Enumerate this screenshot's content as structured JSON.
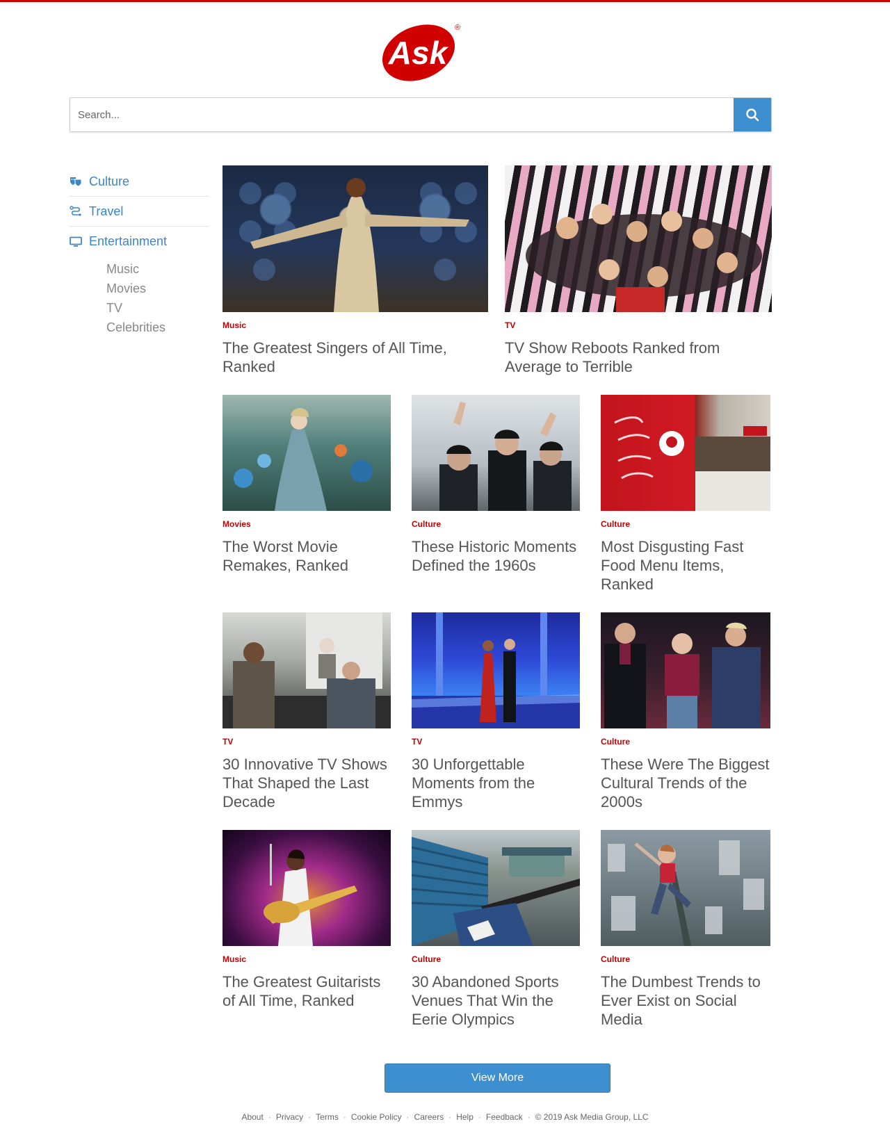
{
  "brand": {
    "logo_text": "Ask",
    "registered": "®",
    "accent": "#d10000",
    "link_blue": "#3b86c6",
    "button_blue": "#3d8fcf"
  },
  "search": {
    "placeholder": "Search...",
    "value": "",
    "icon": "search-icon"
  },
  "sidebar": {
    "items": [
      {
        "label": "Culture",
        "icon": "theater-masks-icon"
      },
      {
        "label": "Travel",
        "icon": "route-icon"
      },
      {
        "label": "Entertainment",
        "icon": "monitor-icon"
      }
    ],
    "subitems": [
      "Music",
      "Movies",
      "TV",
      "Celebrities"
    ]
  },
  "articles": [
    {
      "category": "Music",
      "title": "The Greatest Singers of All Time, Ranked",
      "image": "singer-on-stage-photo"
    },
    {
      "category": "TV",
      "title": "TV Show Reboots Ranked from Average to Terrible",
      "image": "tv-cast-group-photo"
    },
    {
      "category": "Movies",
      "title": "The Worst Movie Remakes, Ranked",
      "image": "fantasy-garden-movie-still"
    },
    {
      "category": "Culture",
      "title": "These Historic Moments Defined the 1960s",
      "image": "band-waving-photo"
    },
    {
      "category": "Culture",
      "title": "Most Disgusting Fast Food Menu Items, Ranked",
      "image": "fast-food-restaurant-photo"
    },
    {
      "category": "TV",
      "title": "30 Innovative TV Shows That Shaped the Last Decade",
      "image": "tv-drama-office-still"
    },
    {
      "category": "TV",
      "title": "30 Unforgettable Moments from the Emmys",
      "image": "awards-stage-photo"
    },
    {
      "category": "Culture",
      "title": "These Were The Biggest Cultural Trends of the 2000s",
      "image": "talent-show-hosts-photo"
    },
    {
      "category": "Music",
      "title": "The Greatest Guitarists of All Time, Ranked",
      "image": "guitarist-concert-photo"
    },
    {
      "category": "Culture",
      "title": "30 Abandoned Sports Venues That Win the Eerie Olympics",
      "image": "abandoned-stadium-photo"
    },
    {
      "category": "Culture",
      "title": "The Dumbest Trends to Ever Exist on Social Media",
      "image": "rooftop-selfie-photo"
    }
  ],
  "view_more": "View More",
  "footer": {
    "links": [
      "About",
      "Privacy",
      "Terms",
      "Cookie Policy",
      "Careers",
      "Help",
      "Feedback"
    ],
    "separator": "·",
    "copyright": "© 2019 Ask Media Group, LLC"
  }
}
